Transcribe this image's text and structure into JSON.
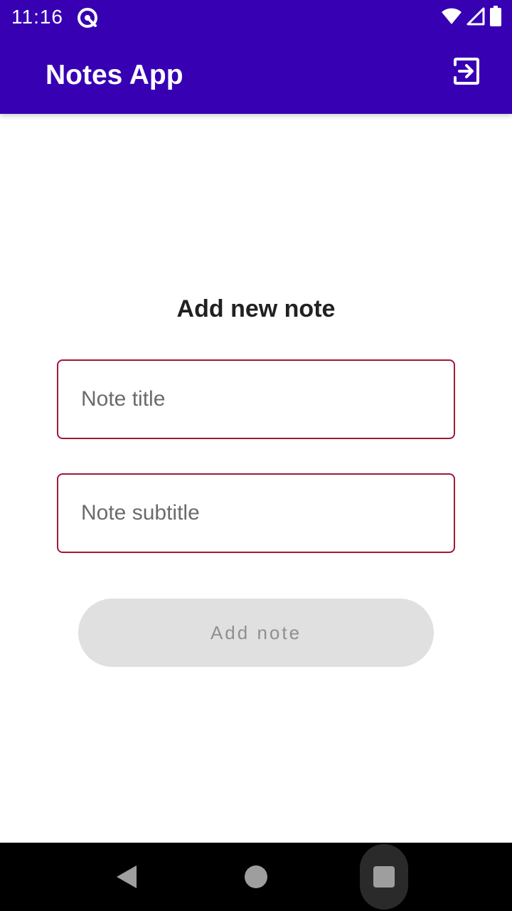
{
  "status_bar": {
    "time": "11:16"
  },
  "app_bar": {
    "title": "Notes App",
    "logout_icon": "logout-icon"
  },
  "form": {
    "heading": "Add new note",
    "title_field": {
      "value": "",
      "placeholder": "Note title"
    },
    "subtitle_field": {
      "value": "",
      "placeholder": "Note subtitle"
    },
    "submit_label": "Add note"
  },
  "colors": {
    "primary": "#3700b3",
    "field_border": "#a01838",
    "button_disabled_bg": "#e0e0e0",
    "button_disabled_text": "#8f8f8f"
  },
  "nav_bar": {
    "icons": [
      "back-icon",
      "home-icon",
      "recents-icon"
    ]
  }
}
